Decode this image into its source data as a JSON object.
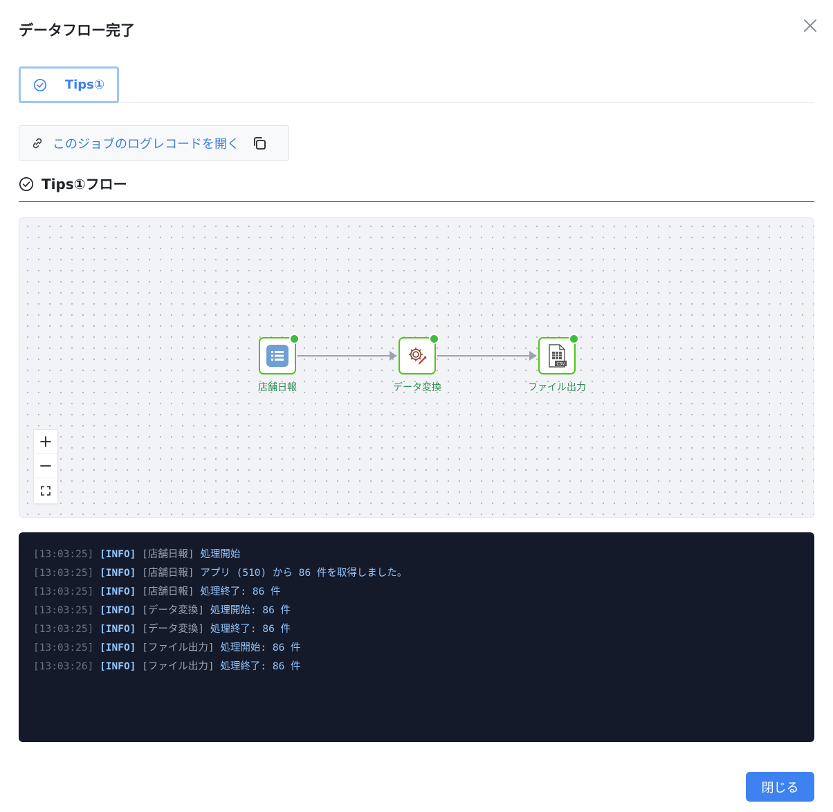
{
  "dialog": {
    "title": "データフロー完了",
    "close_icon": "close-icon"
  },
  "tabs": [
    {
      "label": "Tips①",
      "icon": "check-circle-icon",
      "active": true
    }
  ],
  "log_link": {
    "label": "このジョブのログレコードを開く",
    "icon": "link-icon",
    "copy_icon": "copy-icon"
  },
  "section": {
    "title": "Tips①フロー",
    "icon": "check-circle-icon"
  },
  "flow": {
    "nodes": [
      {
        "label": "店舗日報",
        "icon": "list-app-icon",
        "status": "success"
      },
      {
        "label": "データ変換",
        "icon": "gear-transform-icon",
        "status": "success"
      },
      {
        "label": "ファイル出力",
        "icon": "csv-file-icon",
        "status": "success"
      }
    ],
    "zoom_controls": [
      "zoom-in-icon",
      "zoom-out-icon",
      "fit-view-icon"
    ],
    "colors": {
      "node_border": "#52c41a",
      "status_dot": "#3dbd3d",
      "edge": "#9ca3af"
    }
  },
  "logs": [
    {
      "time": "[13:03:25]",
      "level": "[INFO]",
      "source": "[店舗日報]",
      "message": "処理開始"
    },
    {
      "time": "[13:03:25]",
      "level": "[INFO]",
      "source": "[店舗日報]",
      "message": "アプリ (510) から 86 件を取得しました。"
    },
    {
      "time": "[13:03:25]",
      "level": "[INFO]",
      "source": "[店舗日報]",
      "message": "処理終了: 86 件"
    },
    {
      "time": "[13:03:25]",
      "level": "[INFO]",
      "source": "[データ変換]",
      "message": "処理開始: 86 件"
    },
    {
      "time": "[13:03:25]",
      "level": "[INFO]",
      "source": "[データ変換]",
      "message": "処理終了: 86 件"
    },
    {
      "time": "[13:03:25]",
      "level": "[INFO]",
      "source": "[ファイル出力]",
      "message": "処理開始: 86 件"
    },
    {
      "time": "[13:03:26]",
      "level": "[INFO]",
      "source": "[ファイル出力]",
      "message": "処理終了: 86 件"
    }
  ],
  "footer": {
    "close_label": "閉じる",
    "accent_color": "#3d82f0"
  }
}
